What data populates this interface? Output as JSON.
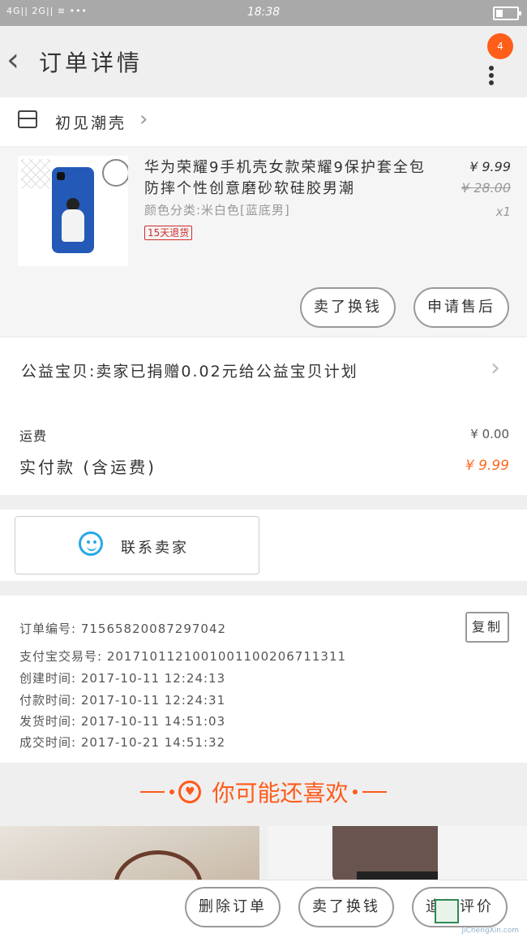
{
  "status_bar": {
    "signal_text": "4G|| 2G|| ≋ •••",
    "time": "18:38"
  },
  "nav": {
    "title": "订单详情",
    "badge_count": "4"
  },
  "shop": {
    "name": "初见潮壳"
  },
  "product": {
    "title": "华为荣耀9手机壳女款荣耀9保护套全包防摔个性创意磨砂软硅胶男潮",
    "sku": "颜色分类:米白色[蓝底男]",
    "tag": "15天退货",
    "price": "¥ 9.99",
    "original_price": "¥ 28.00",
    "quantity": "x1",
    "buttons": [
      "卖了换钱",
      "申请售后"
    ]
  },
  "charity": {
    "text": "公益宝贝:卖家已捐赠0.02元给公益宝贝计划"
  },
  "fees": {
    "shipping_label": "运费",
    "shipping_value": "¥ 0.00",
    "paid_label": "实付款 (含运费)",
    "paid_value": "¥ 9.99"
  },
  "contact": {
    "label": "联系卖家"
  },
  "order_info": {
    "order_no": "订单编号: 71565820087297042",
    "alipay_no": "支付宝交易号: 2017101121001001100206711311",
    "created": "创建时间: 2017-10-11 12:24:13",
    "paid": "付款时间: 2017-10-11 12:24:31",
    "shipped": "发货时间: 2017-10-11 14:51:03",
    "completed": "成交时间: 2017-10-21 14:51:32",
    "copy_label": "复制"
  },
  "recommend": {
    "title": "你可能还喜欢"
  },
  "bottom_bar": {
    "buttons": [
      "删除订单",
      "卖了换钱",
      "追加评价"
    ]
  },
  "watermark": "JiChengXin.com",
  "colors": {
    "accent": "#ff5a1a",
    "contact_blue": "#27a8e8",
    "tag_red": "#d12b2b"
  }
}
